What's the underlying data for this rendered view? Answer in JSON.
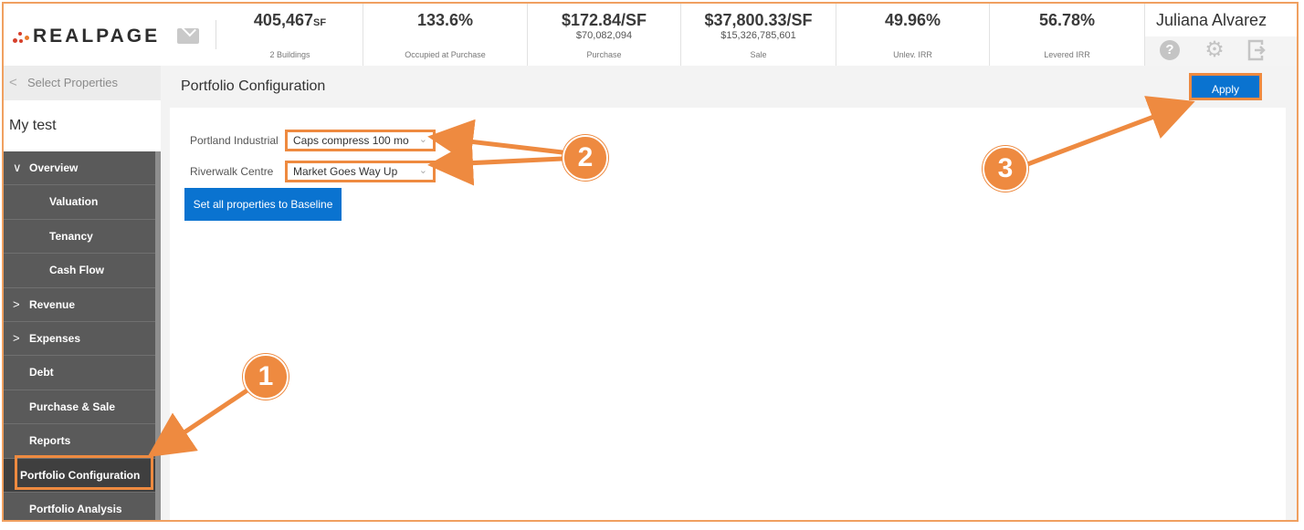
{
  "header": {
    "logo_text": "REALPAGE",
    "metrics": [
      {
        "value": "405,467",
        "unit": "SF",
        "sub": "",
        "caption": "2 Buildings"
      },
      {
        "value": "133.6%",
        "unit": "",
        "sub": "",
        "caption": "Occupied at Purchase"
      },
      {
        "value": "$172.84/SF",
        "unit": "",
        "sub": "$70,082,094",
        "caption": "Purchase"
      },
      {
        "value": "$37,800.33/SF",
        "unit": "",
        "sub": "$15,326,785,601",
        "caption": "Sale"
      },
      {
        "value": "49.96%",
        "unit": "",
        "sub": "",
        "caption": "Unlev. IRR"
      },
      {
        "value": "56.78%",
        "unit": "",
        "sub": "",
        "caption": "Levered IRR"
      }
    ],
    "user_name": "Juliana Alvarez",
    "icons": [
      "mail-icon",
      "help-icon",
      "gear-icon",
      "logout-icon"
    ]
  },
  "sidebar": {
    "select_properties": "Select Properties",
    "project_name": "My test",
    "items": [
      {
        "label": "Overview",
        "caret": "∨"
      },
      {
        "label": "Valuation"
      },
      {
        "label": "Tenancy"
      },
      {
        "label": "Cash Flow"
      },
      {
        "label": "Revenue",
        "caret": ">"
      },
      {
        "label": "Expenses",
        "caret": ">"
      },
      {
        "label": "Debt"
      },
      {
        "label": "Purchase & Sale"
      },
      {
        "label": "Reports"
      },
      {
        "label": "Portfolio Configuration"
      },
      {
        "label": "Portfolio Analysis"
      }
    ]
  },
  "main": {
    "title": "Portfolio Configuration",
    "apply_label": "Apply",
    "properties": [
      {
        "name": "Portland Industrial",
        "scenario": "Caps compress 100 mo"
      },
      {
        "name": "Riverwalk Centre",
        "scenario": "Market Goes Way Up"
      }
    ],
    "baseline_label": "Set all properties to Baseline"
  },
  "annotations": {
    "badges": [
      "1",
      "2",
      "3"
    ],
    "color": "#ee8a40"
  },
  "colors": {
    "brand_red": "#d6402b",
    "primary_blue": "#0a73d0",
    "sidebar_bg": "#5a5a5a",
    "highlight_orange": "#ee8a40"
  }
}
